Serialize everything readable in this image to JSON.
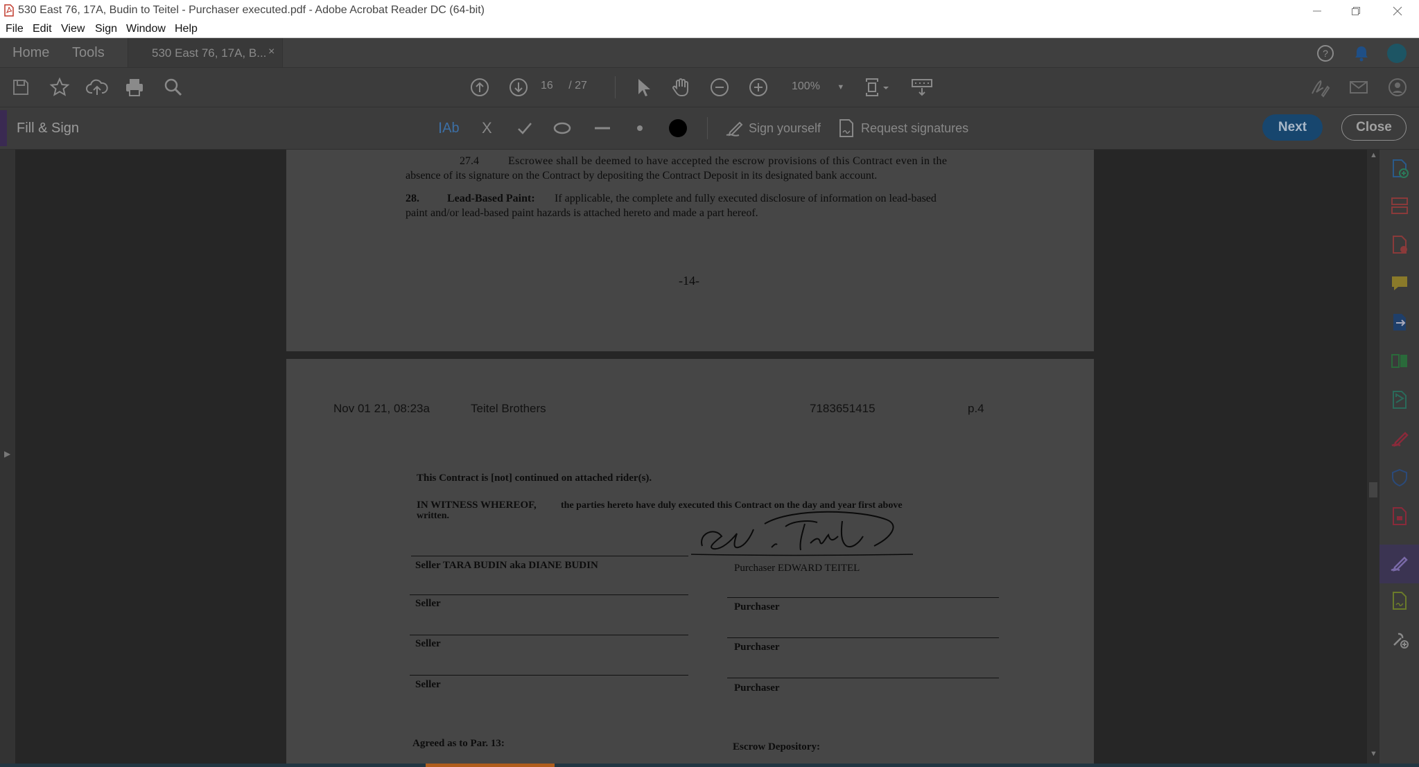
{
  "window": {
    "title": "530 East 76, 17A, Budin to Teitel - Purchaser executed.pdf - Adobe Acrobat Reader DC (64-bit)"
  },
  "menu": [
    "File",
    "Edit",
    "View",
    "Sign",
    "Window",
    "Help"
  ],
  "tabs": {
    "home": "Home",
    "tools": "Tools",
    "document": "530 East 76, 17A, B...",
    "close_glyph": "×"
  },
  "toolbar": {
    "current_page": "16",
    "total_pages": "/ 27",
    "zoom": "100%"
  },
  "fill_sign": {
    "label": "Fill & Sign",
    "text_tool": "Ab",
    "cross_glyph": "X",
    "sign_yourself": "Sign yourself",
    "request_signatures": "Request signatures",
    "next": "Next",
    "close": "Close"
  },
  "page1": {
    "p274_num": "27.4",
    "p274_line1": "Escrowee shall be deemed to have accepted the escrow provisions of this Contract even in the",
    "p274_line2": "absence of its signature on the Contract by depositing the Contract Deposit in its designated bank account.",
    "p28_num": "28.",
    "p28_heading": "Lead-Based Paint:",
    "p28_line1": "If applicable, the complete and fully executed disclosure of information on lead-based",
    "p28_line2": "paint and/or lead-based paint hazards is attached hereto and made a part hereof.",
    "page_number": "-14-"
  },
  "page2": {
    "fax_date": "Nov 01 21, 08:23a",
    "fax_sender": "Teitel Brothers",
    "fax_phone": "7183651415",
    "fax_page": "p.4",
    "rider_line": "This Contract is [not] continued on attached rider(s).",
    "witness_bold": "IN WITNESS WHEREOF,",
    "witness_line1": "the parties hereto have duly executed this Contract on the day and year first above",
    "witness_line2": "written.",
    "seller1": "Seller TARA BUDIN aka DIANE BUDIN",
    "purchaser1": "Purchaser EDWARD TEITEL",
    "seller2": "Seller",
    "purchaser2": "Purchaser",
    "seller3": "Seller",
    "purchaser3": "Purchaser",
    "seller4": "Seller",
    "purchaser4": "Purchaser",
    "agreed": "Agreed as to Par. 13:",
    "escrow": "Escrow Depository:"
  },
  "icons": {
    "right_panel": [
      "create-pdf-icon",
      "organize-pages-icon",
      "edit-pdf-icon",
      "comment-icon",
      "export-pdf-icon",
      "combine-files-icon",
      "send-for-review-icon",
      "fill-sign-icon",
      "protect-icon",
      "compress-pdf-icon",
      "fill-sign-active-icon",
      "prepare-form-icon",
      "more-tools-icon"
    ]
  },
  "colors": {
    "accent_blue": "#17466e",
    "fill_sign_purple": "#3b3452",
    "notification_blue": "#1f4f86"
  }
}
